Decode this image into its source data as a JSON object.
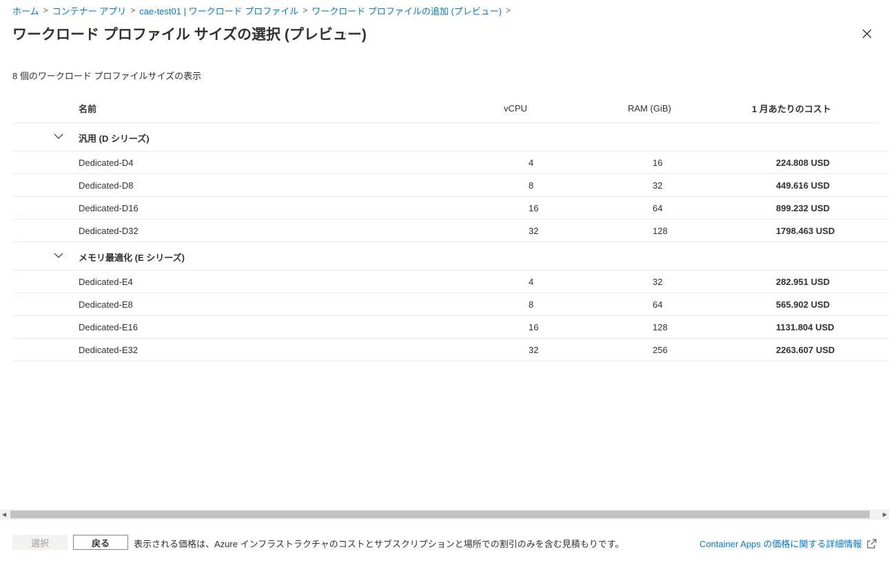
{
  "breadcrumb": {
    "items": [
      "ホーム",
      "コンテナー アプリ",
      "cae-test01 | ワークロード プロファイル",
      "ワークロード プロファイルの追加 (プレビュー)"
    ]
  },
  "header": {
    "title": "ワークロード プロファイル サイズの選択 (プレビュー)",
    "more_icon": "ellipsis-icon",
    "more_label": "···",
    "close_icon": "close-icon"
  },
  "summary": "8 個のワークロード プロファイルサイズの表示",
  "table": {
    "columns": [
      "名前",
      "vCPU",
      "RAM (GiB)",
      "1 月あたりのコスト"
    ],
    "groups": [
      {
        "label": "汎用 (D シリーズ)",
        "rows": [
          {
            "name": "Dedicated-D4",
            "vcpu": "4",
            "ram": "16",
            "cost": "224.808 USD"
          },
          {
            "name": "Dedicated-D8",
            "vcpu": "8",
            "ram": "32",
            "cost": "449.616 USD"
          },
          {
            "name": "Dedicated-D16",
            "vcpu": "16",
            "ram": "64",
            "cost": "899.232 USD"
          },
          {
            "name": "Dedicated-D32",
            "vcpu": "32",
            "ram": "128",
            "cost": "1798.463 USD"
          }
        ]
      },
      {
        "label": "メモリ最適化 (E シリーズ)",
        "rows": [
          {
            "name": "Dedicated-E4",
            "vcpu": "4",
            "ram": "32",
            "cost": "282.951 USD"
          },
          {
            "name": "Dedicated-E8",
            "vcpu": "8",
            "ram": "64",
            "cost": "565.902 USD"
          },
          {
            "name": "Dedicated-E16",
            "vcpu": "16",
            "ram": "128",
            "cost": "1131.804 USD"
          },
          {
            "name": "Dedicated-E32",
            "vcpu": "32",
            "ram": "256",
            "cost": "2263.607 USD"
          }
        ]
      }
    ]
  },
  "footer": {
    "select_label": "選択",
    "back_label": "戻る",
    "note": "表示される価格は、Azure インフラストラクチャのコストとサブスクリプションと場所での割引のみを含む見積もりです。",
    "link_label": "Container Apps の価格に関する詳細情報",
    "link_icon": "external-link-icon"
  },
  "colors": {
    "accent": "#0078d4",
    "text": "#323130",
    "divider": "#edebe9"
  }
}
